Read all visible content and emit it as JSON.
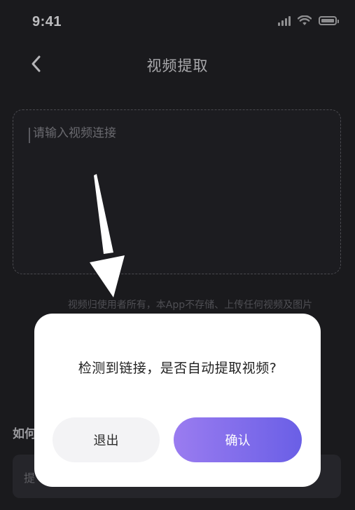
{
  "status_bar": {
    "time": "9:41",
    "icons": [
      "cellular-signal-icon",
      "wifi-icon",
      "battery-icon"
    ]
  },
  "nav": {
    "back_icon": "chevron-left-icon",
    "title": "视频提取"
  },
  "link_input": {
    "placeholder": "请输入视频连接",
    "value": ""
  },
  "disclaimer": "视频归使用者所有，本App不存储、上传任何视频及图片",
  "help_section": {
    "title": "如何",
    "box_text": "提"
  },
  "dialog": {
    "message": "检测到链接，是否自动提取视频?",
    "cancel_label": "退出",
    "confirm_label": "确认"
  },
  "colors": {
    "background": "#1a1a1d",
    "accent_gradient_start": "#9a7cf0",
    "accent_gradient_end": "#6a5fe6",
    "dialog_background": "#ffffff"
  }
}
